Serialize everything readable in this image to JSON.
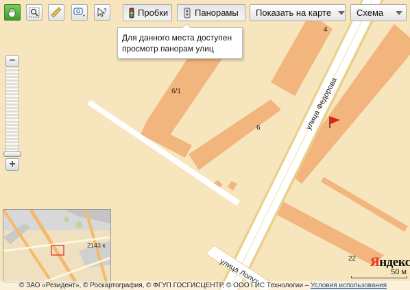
{
  "toolbar": {
    "tools": [
      {
        "name": "hand-tool-icon",
        "active": true
      },
      {
        "name": "zoom-region-icon",
        "active": false
      },
      {
        "name": "ruler-icon",
        "active": false
      },
      {
        "name": "balloon-search-icon",
        "active": false
      },
      {
        "name": "what-here-icon",
        "active": false
      }
    ],
    "traffic_label": "Пробки",
    "panoramas_label": "Панорамы",
    "show_on_map_label": "Показать на карте",
    "map_type_label": "Схема"
  },
  "tooltip": {
    "line1": "Для данного места доступен",
    "line2": "просмотр панорам улиц"
  },
  "zoom": {
    "level_fraction": 0.97
  },
  "map": {
    "streets": [
      "улица Федорова",
      "улица Лопух"
    ],
    "house_numbers": [
      "4",
      "6/1",
      "6",
      "22"
    ],
    "minimap_label": "2143 к",
    "colors": {
      "land": "#f7e6bd",
      "building": "#f2b57d",
      "road_major": "#ffffff",
      "road_edge": "#e8d08a"
    }
  },
  "logo": {
    "first": "Я",
    "rest": "ндекс"
  },
  "scale": {
    "label": "50 м"
  },
  "copyright": {
    "text": "© ЗАО «Резидент», © Роскартография, © ФГУП ГОСГИСЦЕНТР, © ООО ГИС Технологии – ",
    "terms_link": "Условия использования"
  }
}
